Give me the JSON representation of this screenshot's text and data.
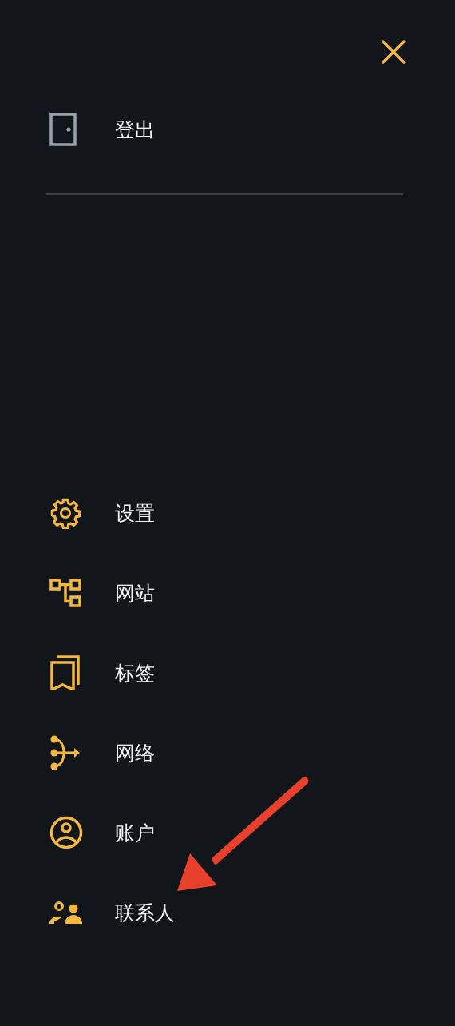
{
  "logout": {
    "label": "登出",
    "kind": "door"
  },
  "menu_items": [
    {
      "label": "设置",
      "kind": "gear"
    },
    {
      "label": "网站",
      "kind": "sitemap"
    },
    {
      "label": "标签",
      "kind": "bookmarks"
    },
    {
      "label": "网络",
      "kind": "network"
    },
    {
      "label": "账户",
      "kind": "account"
    },
    {
      "label": "联系人",
      "kind": "contacts"
    }
  ],
  "annotation": {
    "kind": "arrow"
  }
}
